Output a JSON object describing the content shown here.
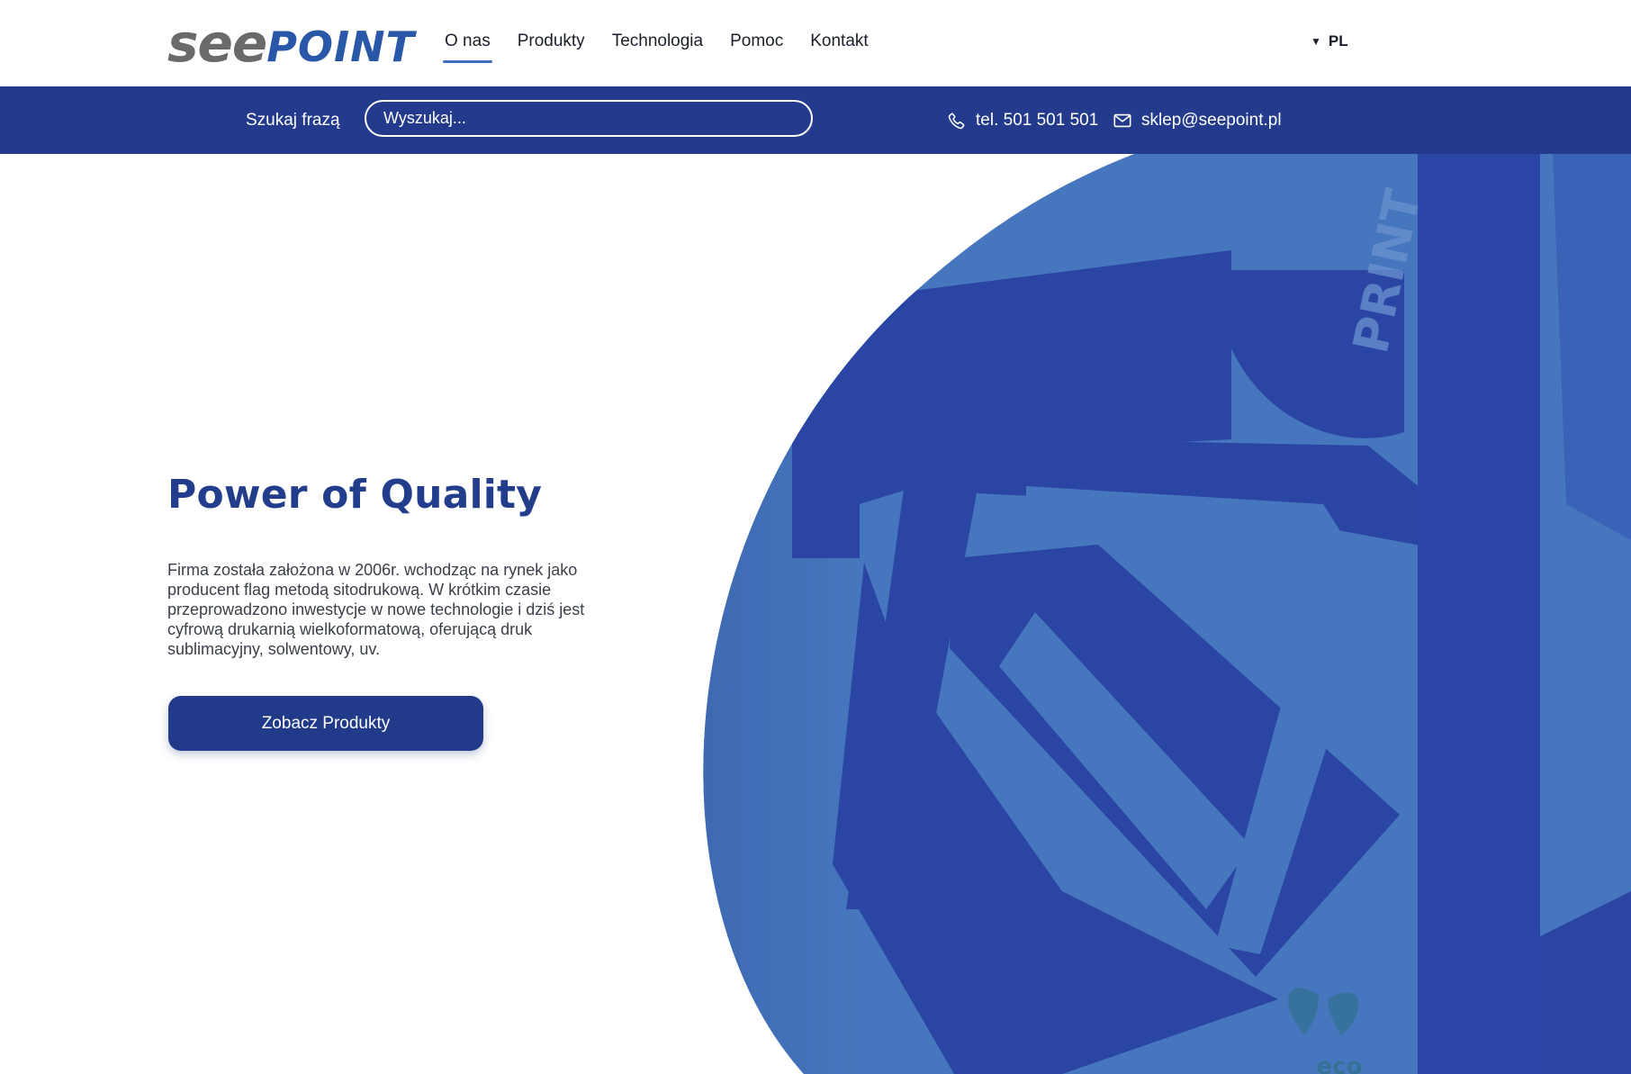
{
  "header": {
    "logo": {
      "part1": "see",
      "part2": "POINT"
    },
    "nav": [
      {
        "label": "O nas",
        "active": true
      },
      {
        "label": "Produkty",
        "active": false
      },
      {
        "label": "Technologia",
        "active": false
      },
      {
        "label": "Pomoc",
        "active": false
      },
      {
        "label": "Kontakt",
        "active": false
      }
    ],
    "language": {
      "caret_icon": "caret-down-icon",
      "label": "PL"
    }
  },
  "search": {
    "label": "Szukaj frazą",
    "placeholder": "Wyszukaj...",
    "value": ""
  },
  "contact": {
    "phone_icon": "phone-icon",
    "phone": "tel. 501 501 501",
    "mail_icon": "mail-icon",
    "email": "sklep@seepoint.pl"
  },
  "hero": {
    "title": "Power of Quality",
    "text": "Firma została założona w 2006r. wchodząc na rynek jako producent flag metodą sitodrukową. W krótkim czasie przeprowadzono inwestycje w nowe technologie i dziś jest cyfrową drukarnią wielkoformatową, oferującą druk sublimacyjny, solwentowy, uv.",
    "cta": "Zobacz Produkty",
    "image_text": {
      "print": "PRINT",
      "eco": "eco"
    }
  },
  "colors": {
    "brand_navy": "#243a8c",
    "brand_blue": "#2a58a8",
    "logo_gray": "#6a6a6a",
    "hero_light": "#4676bd",
    "hero_dark": "#2a45a4"
  }
}
